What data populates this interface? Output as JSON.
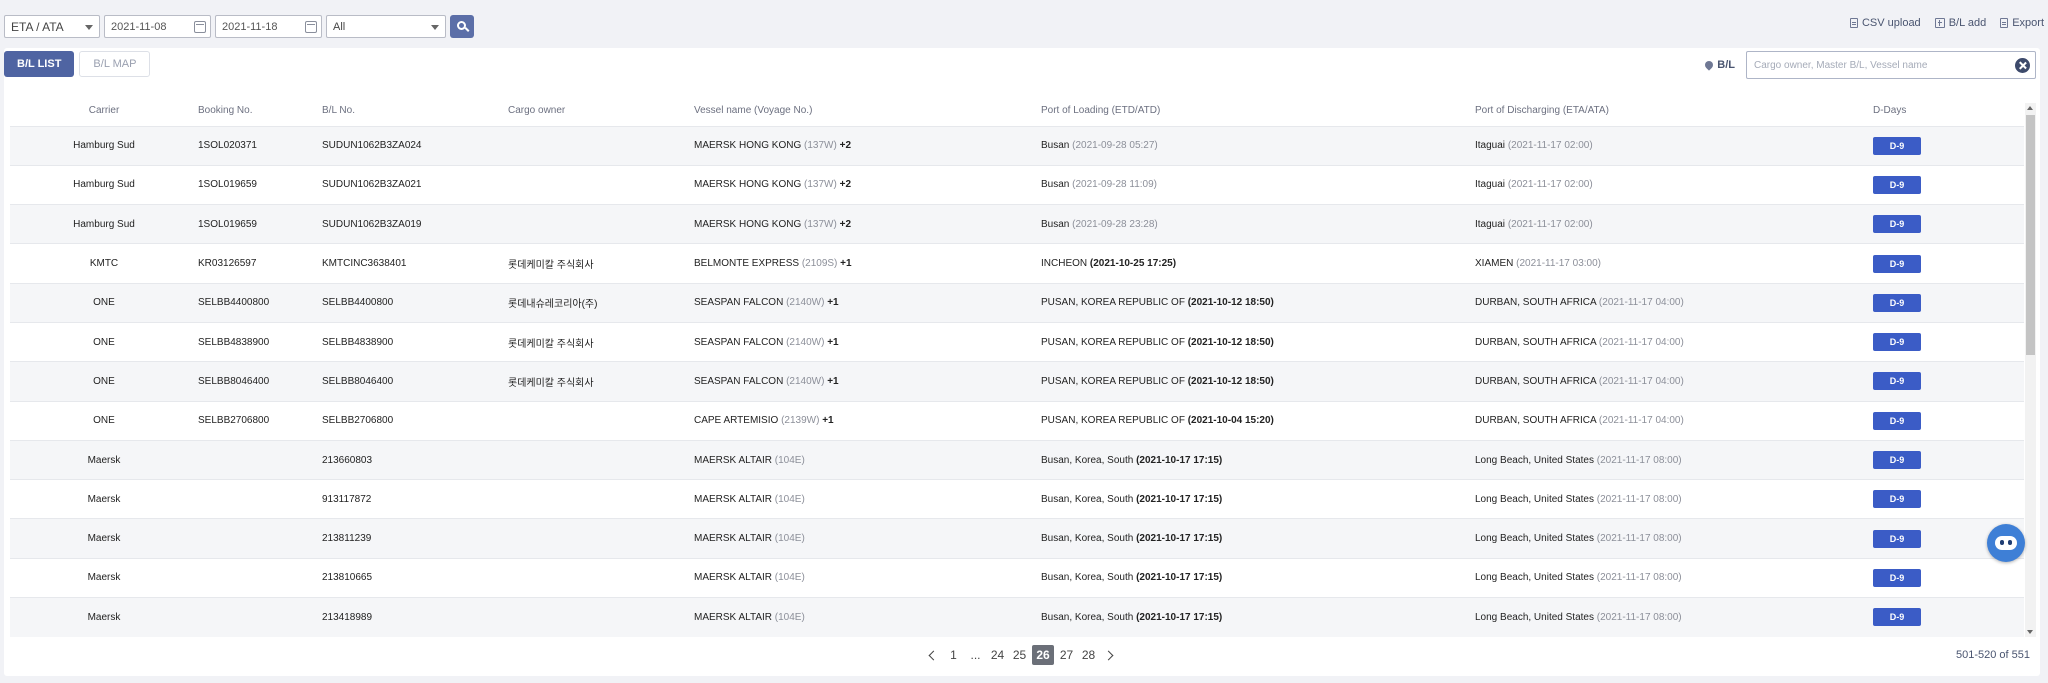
{
  "filters": {
    "date_type": "ETA / ATA",
    "date_from": "2021-11-08",
    "date_to": "2021-11-18",
    "status": "All"
  },
  "top_actions": {
    "csv_upload": "CSV upload",
    "bl_add": "B/L add",
    "export": "Export"
  },
  "tabs": {
    "bl_list": "B/L LIST",
    "bl_map": "B/L MAP"
  },
  "search": {
    "label": "B/L",
    "placeholder": "Cargo owner, Master B/L, Vessel name"
  },
  "columns": {
    "carrier": "Carrier",
    "booking": "Booking No.",
    "bl": "B/L No.",
    "cargo_owner": "Cargo owner",
    "vessel": "Vessel name (Voyage No.)",
    "pol": "Port of Loading (ETD/ATD)",
    "pod": "Port of Discharging (ETA/ATA)",
    "dday": "D-Days"
  },
  "rows": [
    {
      "carrier": "Hamburg Sud",
      "booking": "1SOL020371",
      "bl": "SUDUN1062B3ZA024",
      "owner": "",
      "vessel": "MAERSK HONG KONG",
      "voyage": "(137W)",
      "extra": "+2",
      "pol": "Busan",
      "pol_time": "(2021-09-28 05:27)",
      "pod": "Itaguai",
      "pod_time": "(2021-11-17 02:00)",
      "dday": "D-9"
    },
    {
      "carrier": "Hamburg Sud",
      "booking": "1SOL019659",
      "bl": "SUDUN1062B3ZA021",
      "owner": "",
      "vessel": "MAERSK HONG KONG",
      "voyage": "(137W)",
      "extra": "+2",
      "pol": "Busan",
      "pol_time": "(2021-09-28 11:09)",
      "pod": "Itaguai",
      "pod_time": "(2021-11-17 02:00)",
      "dday": "D-9"
    },
    {
      "carrier": "Hamburg Sud",
      "booking": "1SOL019659",
      "bl": "SUDUN1062B3ZA019",
      "owner": "",
      "vessel": "MAERSK HONG KONG",
      "voyage": "(137W)",
      "extra": "+2",
      "pol": "Busan",
      "pol_time": "(2021-09-28 23:28)",
      "pod": "Itaguai",
      "pod_time": "(2021-11-17 02:00)",
      "dday": "D-9"
    },
    {
      "carrier": "KMTC",
      "booking": "KR03126597",
      "bl": "KMTCINC3638401",
      "owner": "롯데케미칼 주식회사",
      "vessel": "BELMONTE EXPRESS",
      "voyage": "(2109S)",
      "extra": "+1",
      "pol": "INCHEON",
      "pol_time": "(2021-10-25 17:25)",
      "pod": "XIAMEN",
      "pod_time": "(2021-11-17 03:00)",
      "dday": "D-9"
    },
    {
      "carrier": "ONE",
      "booking": "SELBB4400800",
      "bl": "SELBB4400800",
      "owner": "롯데내슈레코리아(주)",
      "vessel": "SEASPAN FALCON",
      "voyage": "(2140W)",
      "extra": "+1",
      "pol": "PUSAN, KOREA REPUBLIC OF",
      "pol_time": "(2021-10-12 18:50)",
      "pod": "DURBAN, SOUTH AFRICA",
      "pod_time": "(2021-11-17 04:00)",
      "dday": "D-9"
    },
    {
      "carrier": "ONE",
      "booking": "SELBB4838900",
      "bl": "SELBB4838900",
      "owner": "롯데케미칼 주식회사",
      "vessel": "SEASPAN FALCON",
      "voyage": "(2140W)",
      "extra": "+1",
      "pol": "PUSAN, KOREA REPUBLIC OF",
      "pol_time": "(2021-10-12 18:50)",
      "pod": "DURBAN, SOUTH AFRICA",
      "pod_time": "(2021-11-17 04:00)",
      "dday": "D-9"
    },
    {
      "carrier": "ONE",
      "booking": "SELBB8046400",
      "bl": "SELBB8046400",
      "owner": "롯데케미칼 주식회사",
      "vessel": "SEASPAN FALCON",
      "voyage": "(2140W)",
      "extra": "+1",
      "pol": "PUSAN, KOREA REPUBLIC OF",
      "pol_time": "(2021-10-12 18:50)",
      "pod": "DURBAN, SOUTH AFRICA",
      "pod_time": "(2021-11-17 04:00)",
      "dday": "D-9"
    },
    {
      "carrier": "ONE",
      "booking": "SELBB2706800",
      "bl": "SELBB2706800",
      "owner": "",
      "vessel": "CAPE ARTEMISIO",
      "voyage": "(2139W)",
      "extra": "+1",
      "pol": "PUSAN, KOREA REPUBLIC OF",
      "pol_time": "(2021-10-04 15:20)",
      "pod": "DURBAN, SOUTH AFRICA",
      "pod_time": "(2021-11-17 04:00)",
      "dday": "D-9"
    },
    {
      "carrier": "Maersk",
      "booking": "",
      "bl": "213660803",
      "owner": "",
      "vessel": "MAERSK ALTAIR",
      "voyage": "(104E)",
      "extra": "",
      "pol": "Busan, Korea, South",
      "pol_time": "(2021-10-17 17:15)",
      "pod": "Long Beach, United States",
      "pod_time": "(2021-11-17 08:00)",
      "dday": "D-9"
    },
    {
      "carrier": "Maersk",
      "booking": "",
      "bl": "913117872",
      "owner": "",
      "vessel": "MAERSK ALTAIR",
      "voyage": "(104E)",
      "extra": "",
      "pol": "Busan, Korea, South",
      "pol_time": "(2021-10-17 17:15)",
      "pod": "Long Beach, United States",
      "pod_time": "(2021-11-17 08:00)",
      "dday": "D-9"
    },
    {
      "carrier": "Maersk",
      "booking": "",
      "bl": "213811239",
      "owner": "",
      "vessel": "MAERSK ALTAIR",
      "voyage": "(104E)",
      "extra": "",
      "pol": "Busan, Korea, South",
      "pol_time": "(2021-10-17 17:15)",
      "pod": "Long Beach, United States",
      "pod_time": "(2021-11-17 08:00)",
      "dday": "D-9"
    },
    {
      "carrier": "Maersk",
      "booking": "",
      "bl": "213810665",
      "owner": "",
      "vessel": "MAERSK ALTAIR",
      "voyage": "(104E)",
      "extra": "",
      "pol": "Busan, Korea, South",
      "pol_time": "(2021-10-17 17:15)",
      "pod": "Long Beach, United States",
      "pod_time": "(2021-11-17 08:00)",
      "dday": "D-9"
    },
    {
      "carrier": "Maersk",
      "booking": "",
      "bl": "213418989",
      "owner": "",
      "vessel": "MAERSK ALTAIR",
      "voyage": "(104E)",
      "extra": "",
      "pol": "Busan, Korea, South",
      "pol_time": "(2021-10-17 17:15)",
      "pod": "Long Beach, United States",
      "pod_time": "(2021-11-17 08:00)",
      "dday": "D-9"
    }
  ],
  "pagination": {
    "first": "1",
    "ellipsis": "...",
    "pages": [
      "24",
      "25",
      "26",
      "27",
      "28"
    ],
    "current": "26",
    "count": "501-520 of 551"
  }
}
